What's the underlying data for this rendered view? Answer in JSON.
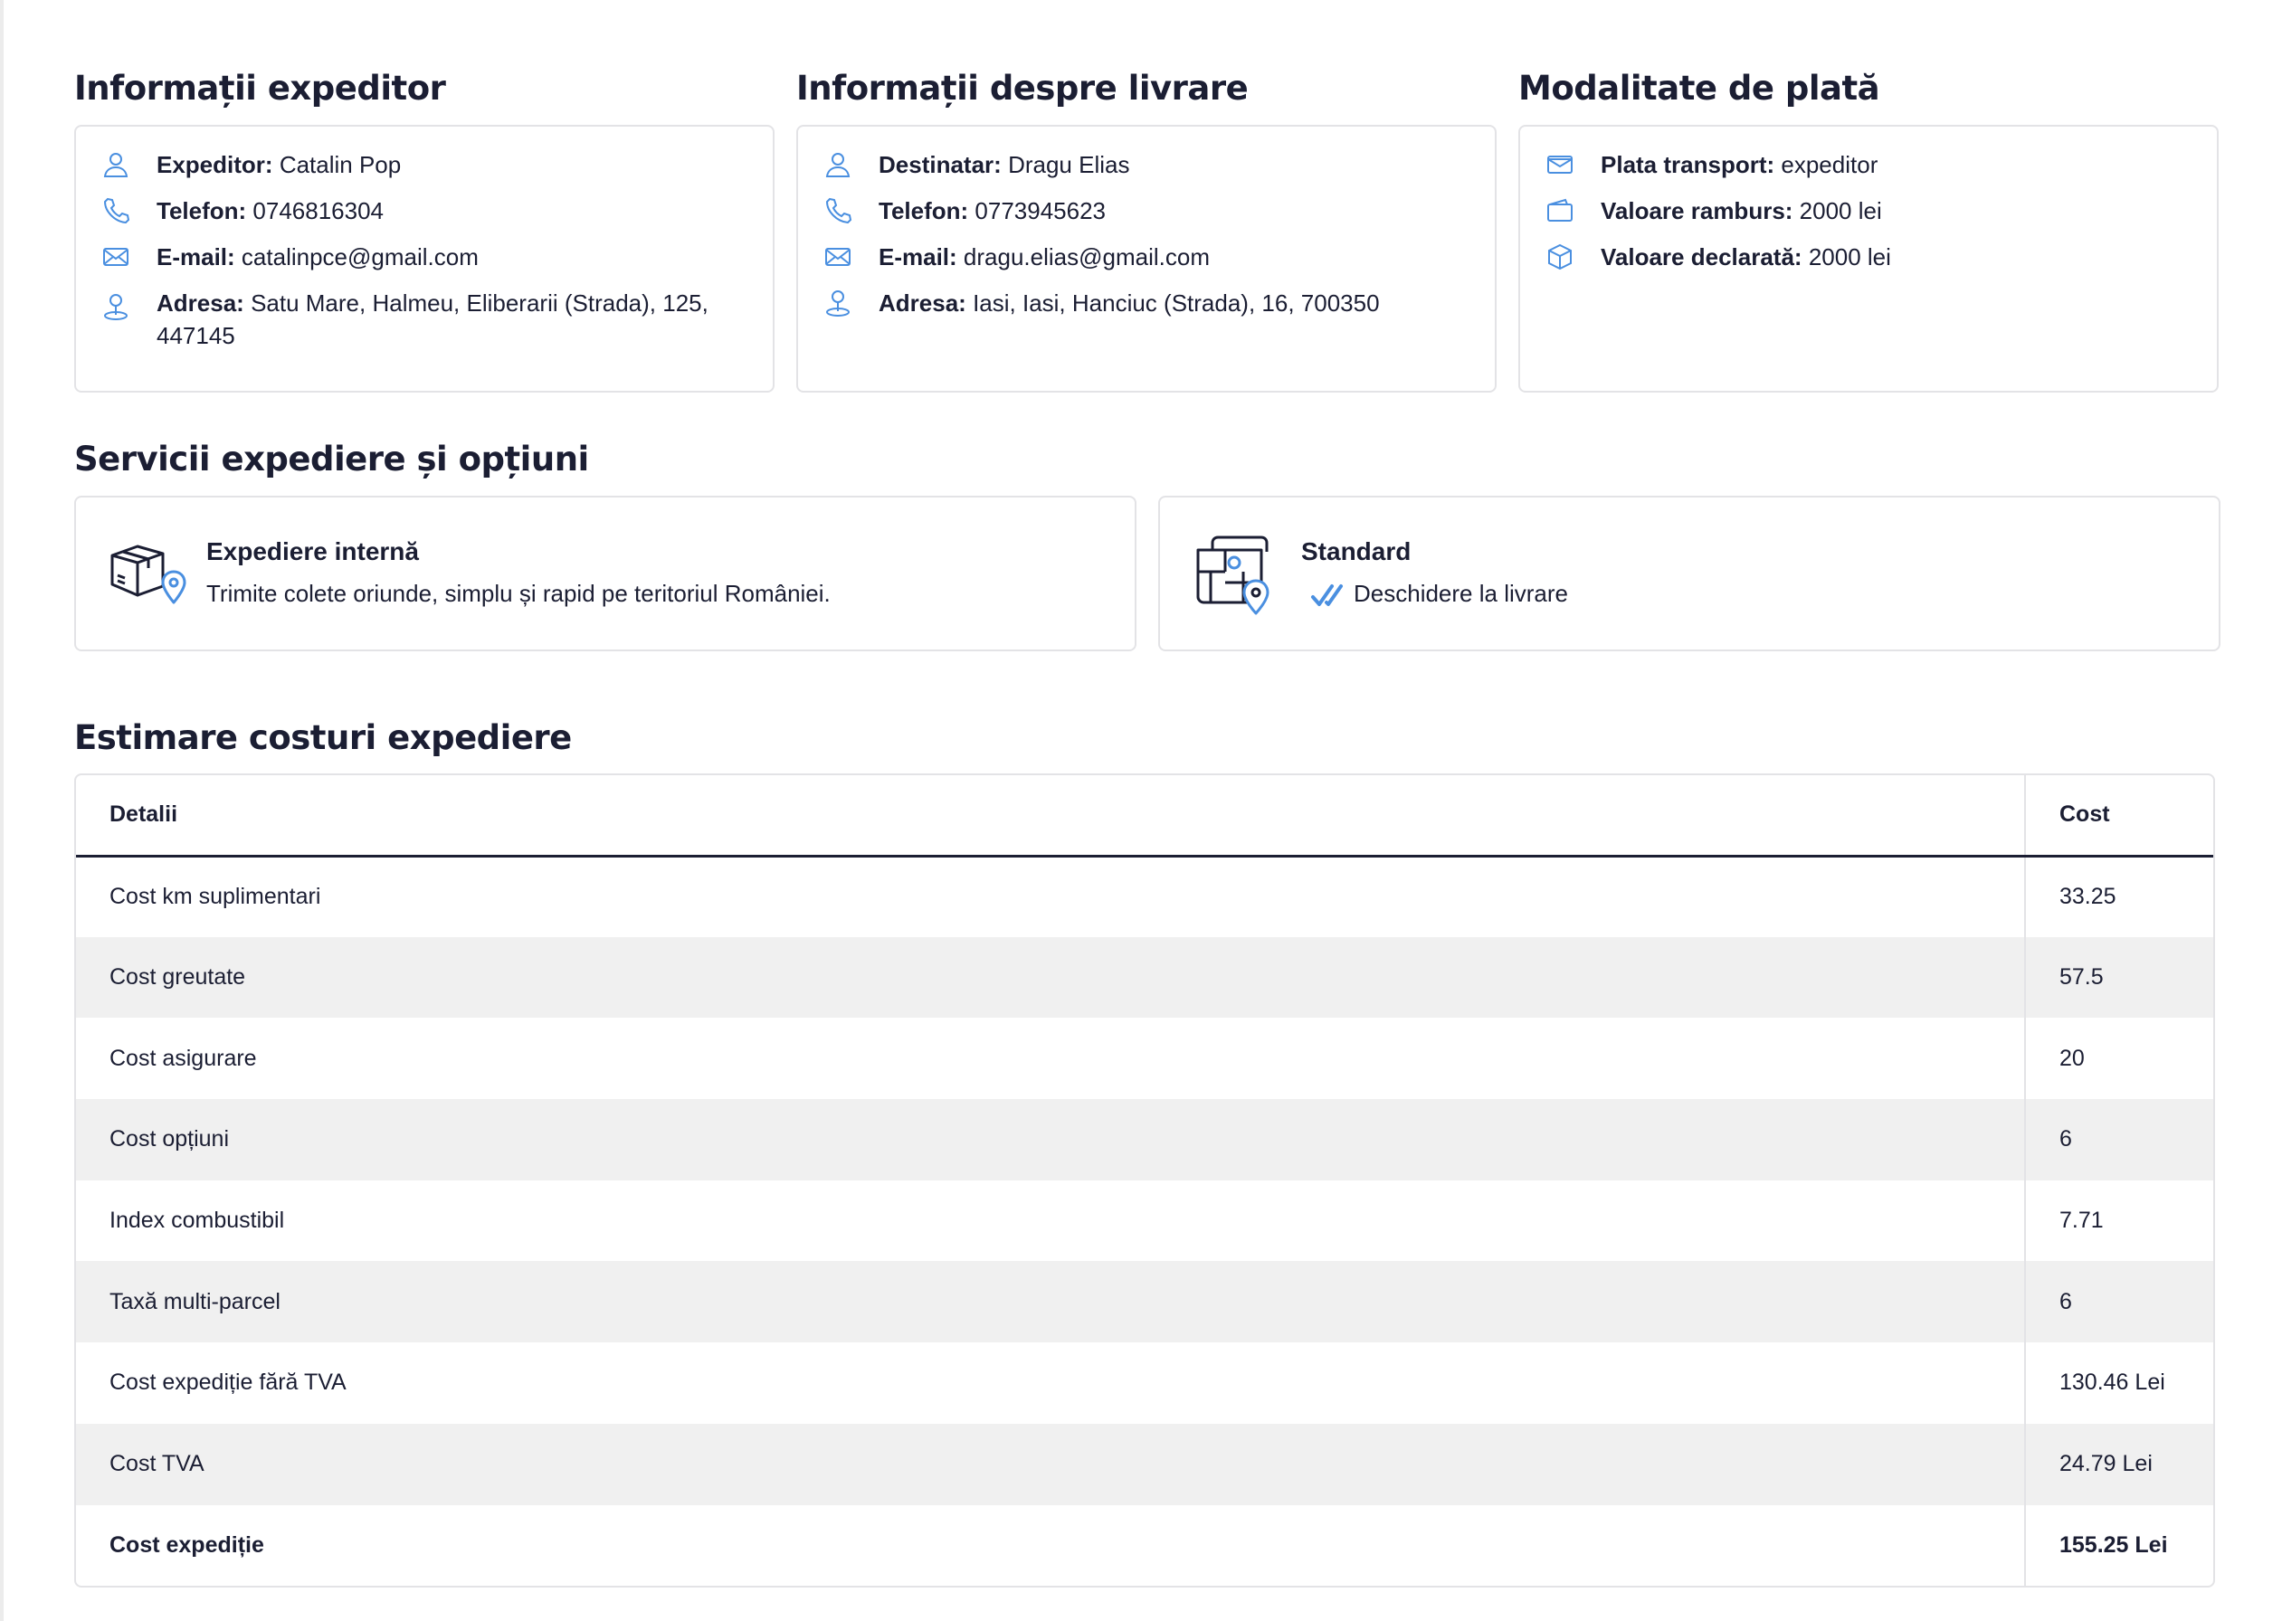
{
  "sender": {
    "title": "Informații expeditor",
    "rows": [
      {
        "label": "Expeditor:",
        "value": "Catalin Pop",
        "icon": "user-icon"
      },
      {
        "label": "Telefon:",
        "value": "0746816304",
        "icon": "phone-icon"
      },
      {
        "label": "E-mail:",
        "value": "catalinpce@gmail.com",
        "icon": "mail-icon"
      },
      {
        "label": "Adresa:",
        "value": "Satu Mare, Halmeu, Eliberarii (Strada), 125, 447145",
        "icon": "location-user-icon"
      }
    ]
  },
  "delivery": {
    "title": "Informații despre livrare",
    "rows": [
      {
        "label": "Destinatar:",
        "value": "Dragu Elias",
        "icon": "user-icon"
      },
      {
        "label": "Telefon:",
        "value": "0773945623",
        "icon": "phone-icon"
      },
      {
        "label": "E-mail:",
        "value": "dragu.elias@gmail.com",
        "icon": "mail-icon"
      },
      {
        "label": "Adresa:",
        "value": "Iasi, Iasi, Hanciuc (Strada), 16, 700350",
        "icon": "location-user-icon"
      }
    ]
  },
  "payment": {
    "title": "Modalitate de plată",
    "rows": [
      {
        "label": "Plata transport:",
        "value": "expeditor",
        "icon": "envelope-icon"
      },
      {
        "label": "Valoare ramburs:",
        "value": "2000 lei",
        "icon": "wallet-icon"
      },
      {
        "label": "Valoare declarată:",
        "value": "2000 lei",
        "icon": "box-icon"
      }
    ]
  },
  "services": {
    "title": "Servicii expediere și opțiuni",
    "items": [
      {
        "title": "Expediere internă",
        "desc": "Trimite colete oriunde, simplu și rapid pe teritoriul României.",
        "icon": "package-location-icon"
      },
      {
        "title": "Standard",
        "desc": "Deschidere la livrare",
        "icon": "map-location-icon",
        "option_icon": "double-check-icon"
      }
    ]
  },
  "costs": {
    "title": "Estimare costuri expediere",
    "headers": [
      "Detalii",
      "Cost"
    ],
    "rows": [
      {
        "detail": "Cost km suplimentari",
        "cost": "33.25"
      },
      {
        "detail": "Cost greutate",
        "cost": "57.5"
      },
      {
        "detail": "Cost asigurare",
        "cost": "20"
      },
      {
        "detail": "Cost opțiuni",
        "cost": "6"
      },
      {
        "detail": "Index combustibil",
        "cost": "7.71"
      },
      {
        "detail": "Taxă multi-parcel",
        "cost": "6"
      },
      {
        "detail": "Cost expediție fără TVA",
        "cost": "130.46 Lei"
      },
      {
        "detail": "Cost TVA",
        "cost": "24.79 Lei"
      },
      {
        "detail": "Cost expediție",
        "cost": "155.25 Lei"
      }
    ]
  },
  "colors": {
    "accent": "#4a8fe0",
    "text": "#1b1e33",
    "stripe": "#f0f0f0",
    "border": "#e3e3e6"
  }
}
